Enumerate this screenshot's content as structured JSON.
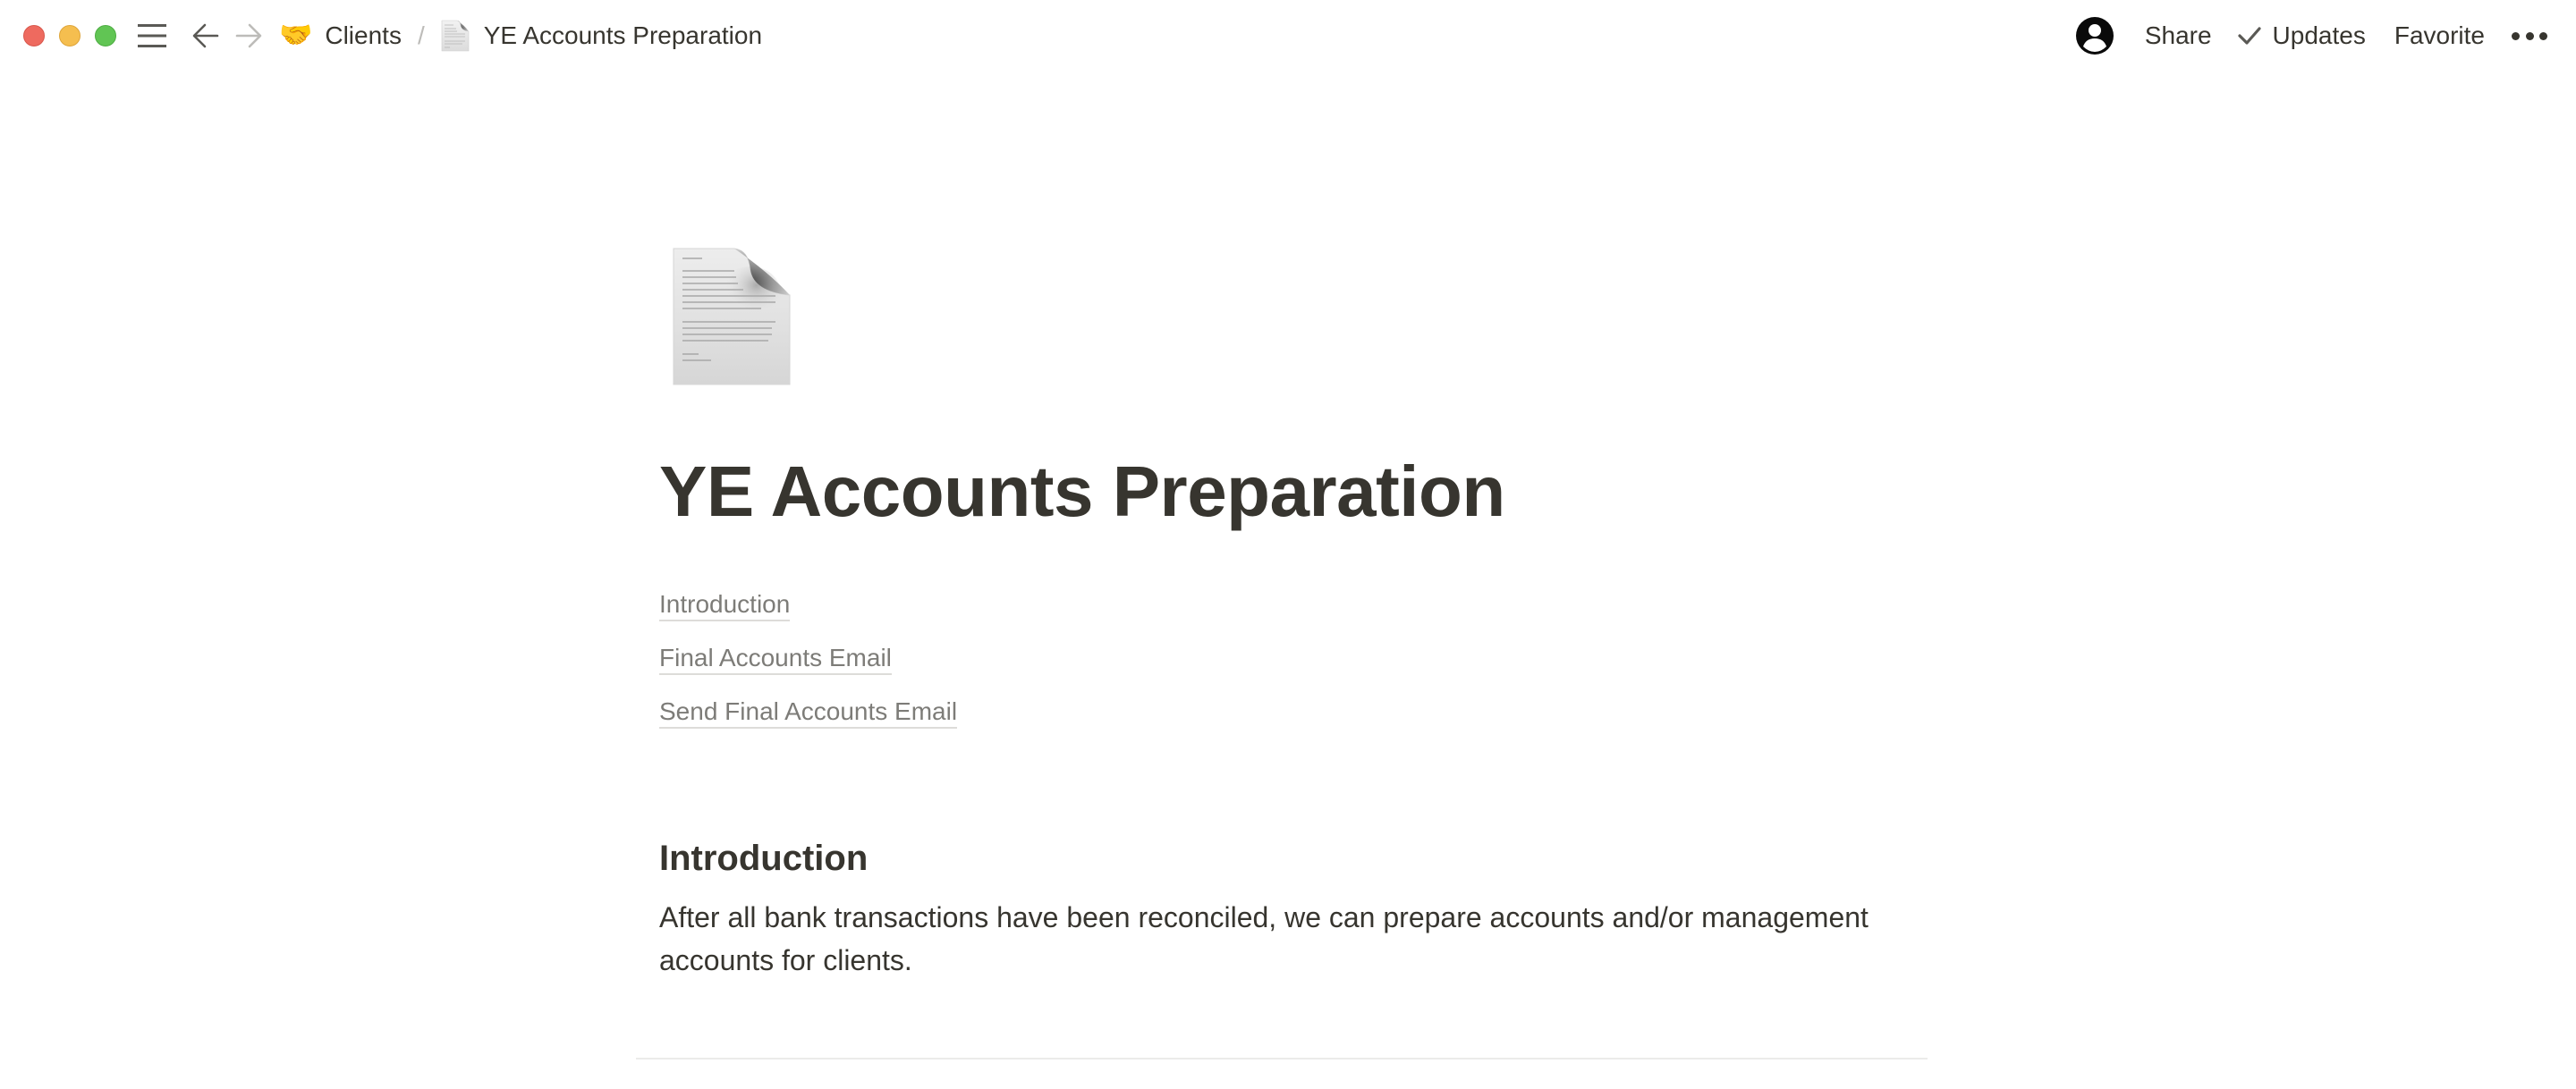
{
  "window": {
    "traffic_lights": {
      "close_color": "#ee6a5f",
      "minimize_color": "#f5be4f",
      "zoom_color": "#61c554"
    }
  },
  "topbar": {
    "breadcrumb": [
      {
        "icon": "handshake-emoji",
        "emoji": "🤝",
        "label": "Clients"
      },
      {
        "icon": "page-document-icon",
        "label": "YE Accounts Preparation"
      }
    ],
    "separator": "/",
    "actions": {
      "share_label": "Share",
      "updates_label": "Updates",
      "favorite_label": "Favorite"
    }
  },
  "page": {
    "icon": "page-document-icon",
    "title": "YE Accounts Preparation",
    "toc": [
      {
        "label": "Introduction"
      },
      {
        "label": "Final Accounts Email"
      },
      {
        "label": "Send Final Accounts Email"
      }
    ],
    "sections": [
      {
        "heading": "Introduction",
        "body": "After all bank transactions have been reconciled, we can prepare accounts and/or management accounts for clients."
      }
    ]
  },
  "colors": {
    "text": "#37352f",
    "muted_link": "#7d7c78",
    "link_underline": "#dddcd9",
    "divider": "#ebebea"
  }
}
